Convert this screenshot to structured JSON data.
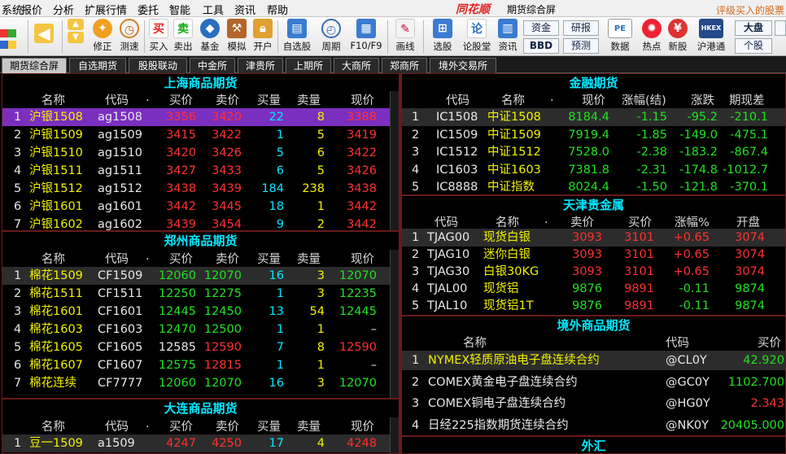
{
  "menu": {
    "items": [
      "系统",
      "报价",
      "分析",
      "扩展行情",
      "委托",
      "智能",
      "工具",
      "资讯",
      "帮助"
    ],
    "logo": "同花顺",
    "title": "期货综合屏",
    "promo": "评级买入的股票"
  },
  "toolbar": {
    "buttons": [
      "修正",
      "测速",
      "买入",
      "卖出",
      "基金",
      "模拟",
      "开户",
      "自选股",
      "周期",
      "F10/F9",
      "画线",
      "选股",
      "论股堂",
      "资讯",
      "数据",
      "热点",
      "新股",
      "沪港通"
    ],
    "fund": "资金",
    "bbd": "BBD",
    "research": "研报",
    "forecast": "预测",
    "market": "大盘",
    "stock": "个股",
    "pe": "PE",
    "hkex": "HKEX"
  },
  "tabs": [
    "期货综合屏",
    "自选期货",
    "股股联动",
    "中金所",
    "津贵所",
    "上期所",
    "大商所",
    "郑商所",
    "境外交易所"
  ],
  "shfe": {
    "title": "上海商品期货",
    "headers": [
      "名称",
      "代码",
      ".",
      "买价",
      "卖价",
      "买量",
      "卖量",
      "现价"
    ],
    "rows": [
      {
        "n": "1",
        "name": "沪银1508",
        "code": "ag1508",
        "bid": "3356",
        "ask": "3420",
        "bv": "22",
        "av": "8",
        "last": "3388"
      },
      {
        "n": "2",
        "name": "沪银1509",
        "code": "ag1509",
        "bid": "3415",
        "ask": "3422",
        "bv": "1",
        "av": "5",
        "last": "3419"
      },
      {
        "n": "3",
        "name": "沪银1510",
        "code": "ag1510",
        "bid": "3420",
        "ask": "3426",
        "bv": "5",
        "av": "6",
        "last": "3422"
      },
      {
        "n": "4",
        "name": "沪银1511",
        "code": "ag1511",
        "bid": "3427",
        "ask": "3433",
        "bv": "6",
        "av": "5",
        "last": "3426"
      },
      {
        "n": "5",
        "name": "沪银1512",
        "code": "ag1512",
        "bid": "3438",
        "ask": "3439",
        "bv": "184",
        "av": "238",
        "last": "3438"
      },
      {
        "n": "6",
        "name": "沪银1601",
        "code": "ag1601",
        "bid": "3442",
        "ask": "3445",
        "bv": "18",
        "av": "1",
        "last": "3442"
      },
      {
        "n": "7",
        "name": "沪银1602",
        "code": "ag1602",
        "bid": "3439",
        "ask": "3454",
        "bv": "9",
        "av": "2",
        "last": "3442"
      }
    ]
  },
  "czce": {
    "title": "郑州商品期货",
    "headers": [
      "名称",
      "代码",
      ".",
      "买价",
      "卖价",
      "买量",
      "卖量",
      "现价"
    ],
    "rows": [
      {
        "n": "1",
        "name": "棉花1509",
        "code": "CF1509",
        "bid": "12060",
        "ask": "12070",
        "bv": "16",
        "av": "3",
        "last": "12070"
      },
      {
        "n": "2",
        "name": "棉花1511",
        "code": "CF1511",
        "bid": "12250",
        "ask": "12275",
        "bv": "1",
        "av": "3",
        "last": "12235"
      },
      {
        "n": "3",
        "name": "棉花1601",
        "code": "CF1601",
        "bid": "12445",
        "ask": "12450",
        "bv": "13",
        "av": "54",
        "last": "12445"
      },
      {
        "n": "4",
        "name": "棉花1603",
        "code": "CF1603",
        "bid": "12470",
        "ask": "12500",
        "bv": "1",
        "av": "1",
        "last": "–"
      },
      {
        "n": "5",
        "name": "棉花1605",
        "code": "CF1605",
        "bid": "12585",
        "ask": "12590",
        "bv": "7",
        "av": "8",
        "last": "12590"
      },
      {
        "n": "6",
        "name": "棉花1607",
        "code": "CF1607",
        "bid": "12575",
        "ask": "12815",
        "bv": "1",
        "av": "1",
        "last": "–"
      },
      {
        "n": "7",
        "name": "棉花连续",
        "code": "CF7777",
        "bid": "12060",
        "ask": "12070",
        "bv": "16",
        "av": "3",
        "last": "12070"
      }
    ]
  },
  "dce": {
    "title": "大连商品期货",
    "headers": [
      "名称",
      "代码",
      ".",
      "买价",
      "卖价",
      "买量",
      "卖量",
      "现价"
    ],
    "rows": [
      {
        "n": "1",
        "name": "豆一1509",
        "code": "a1509",
        "bid": "4247",
        "ask": "4250",
        "bv": "17",
        "av": "4",
        "last": "4248"
      }
    ]
  },
  "cffex": {
    "title": "金融期货",
    "headers": [
      "代码",
      "名称",
      ".",
      "现价",
      "涨幅(结)",
      "涨跌",
      "期现差"
    ],
    "rows": [
      {
        "n": "1",
        "code": "IC1508",
        "name": "中证1508",
        "last": "8184.4",
        "pct": "-1.15",
        "chg": "-95.2",
        "basis": "-210.1"
      },
      {
        "n": "2",
        "code": "IC1509",
        "name": "中证1509",
        "last": "7919.4",
        "pct": "-1.85",
        "chg": "-149.0",
        "basis": "-475.1"
      },
      {
        "n": "3",
        "code": "IC1512",
        "name": "中证1512",
        "last": "7528.0",
        "pct": "-2.38",
        "chg": "-183.2",
        "basis": "-867.4"
      },
      {
        "n": "4",
        "code": "IC1603",
        "name": "中证1603",
        "last": "7381.8",
        "pct": "-2.31",
        "chg": "-174.8",
        "basis": "-1012.7"
      },
      {
        "n": "5",
        "code": "IC8888",
        "name": "中证指数",
        "last": "8024.4",
        "pct": "-1.50",
        "chg": "-121.8",
        "basis": "-370.1"
      }
    ]
  },
  "tjpme": {
    "title": "天津贵金属",
    "headers": [
      "代码",
      "名称",
      ".",
      "卖价",
      "买价",
      "涨幅%",
      "开盘"
    ],
    "rows": [
      {
        "n": "1",
        "code": "TJAG00",
        "name": "现货白银",
        "ask": "3093",
        "bid": "3101",
        "pct": "+0.65",
        "open": "3074"
      },
      {
        "n": "2",
        "code": "TJAG10",
        "name": "迷你白银",
        "ask": "3093",
        "bid": "3101",
        "pct": "+0.65",
        "open": "3074"
      },
      {
        "n": "3",
        "code": "TJAG30",
        "name": "白银30KG",
        "ask": "3093",
        "bid": "3101",
        "pct": "+0.65",
        "open": "3074"
      },
      {
        "n": "4",
        "code": "TJAL00",
        "name": "现货铝",
        "ask": "9876",
        "bid": "9891",
        "pct": "-0.11",
        "open": "9874"
      },
      {
        "n": "5",
        "code": "TJAL10",
        "name": "现货铝1T",
        "ask": "9876",
        "bid": "9891",
        "pct": "-0.11",
        "open": "9874"
      }
    ]
  },
  "overseas": {
    "title": "境外商品期货",
    "headers": [
      "名称",
      "代码",
      "买价"
    ],
    "rows": [
      {
        "n": "1",
        "name": "NYMEX轻质原油电子盘连续合约",
        "code": "@CL0Y",
        "bid": "42.920"
      },
      {
        "n": "2",
        "name": "COMEX黄金电子盘连续合约",
        "code": "@GC0Y",
        "bid": "1102.700"
      },
      {
        "n": "3",
        "name": "COMEX铜电子盘连续合约",
        "code": "@HG0Y",
        "bid": "2.343"
      },
      {
        "n": "4",
        "name": "日经225指数期货连续合约",
        "code": "@NK0Y",
        "bid": "20405.000"
      }
    ]
  },
  "forex": {
    "title": "外汇"
  },
  "colors": {
    "up": "#ff3030",
    "down": "#20e020",
    "name": "#f0f000",
    "title": "#00e8ff",
    "selected_row": "#7b2fbf"
  }
}
